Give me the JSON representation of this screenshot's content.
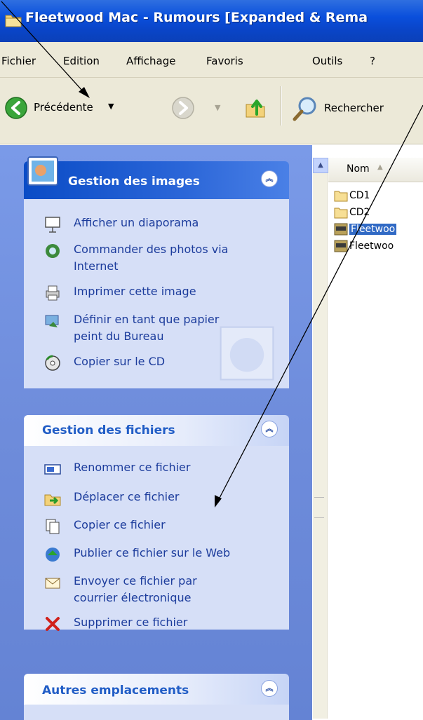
{
  "window": {
    "title": "Fleetwood Mac - Rumours [Expanded & Rema"
  },
  "menubar": {
    "items": [
      "Fichier",
      "Edition",
      "Affichage",
      "Favoris",
      "Outils",
      "?"
    ]
  },
  "toolbar": {
    "back_label": "Précédente",
    "search_label": "Rechercher"
  },
  "panels": {
    "images": {
      "title": "Gestion des images",
      "tasks": [
        {
          "label": "Afficher un diaporama",
          "icon": "slideshow-icon"
        },
        {
          "label": "Commander des photos via",
          "label2": "Internet",
          "icon": "order-photos-icon"
        },
        {
          "label": "Imprimer cette image",
          "icon": "print-icon"
        },
        {
          "label": "Définir en tant que papier",
          "label2": "peint du Bureau",
          "icon": "wallpaper-icon"
        },
        {
          "label": "Copier sur le CD",
          "icon": "cd-icon"
        }
      ]
    },
    "files": {
      "title": "Gestion des fichiers",
      "tasks": [
        {
          "label": "Renommer ce fichier",
          "icon": "rename-icon"
        },
        {
          "label": "Déplacer ce fichier",
          "icon": "move-icon"
        },
        {
          "label": "Copier ce fichier",
          "icon": "copy-icon"
        },
        {
          "label": "Publier ce fichier sur le Web",
          "icon": "web-publish-icon"
        },
        {
          "label": "Envoyer ce fichier par",
          "label2": "courrier électronique",
          "icon": "email-icon"
        },
        {
          "label": "Supprimer ce fichier",
          "icon": "delete-icon"
        }
      ]
    },
    "other": {
      "title": "Autres emplacements"
    }
  },
  "filelist": {
    "column_name": "Nom",
    "items": [
      {
        "name": "CD1",
        "type": "folder"
      },
      {
        "name": "CD2",
        "type": "folder"
      },
      {
        "name": "Fleetwoo",
        "type": "jpg",
        "selected": true
      },
      {
        "name": "Fleetwoo",
        "type": "jpg",
        "selected": false
      }
    ]
  },
  "colors": {
    "title_bar": "#0a4fdc",
    "sidebar": "#6e8cdb",
    "panel_body": "#d6dff7",
    "link_text": "#1c3c9c",
    "selection": "#316ac5"
  }
}
